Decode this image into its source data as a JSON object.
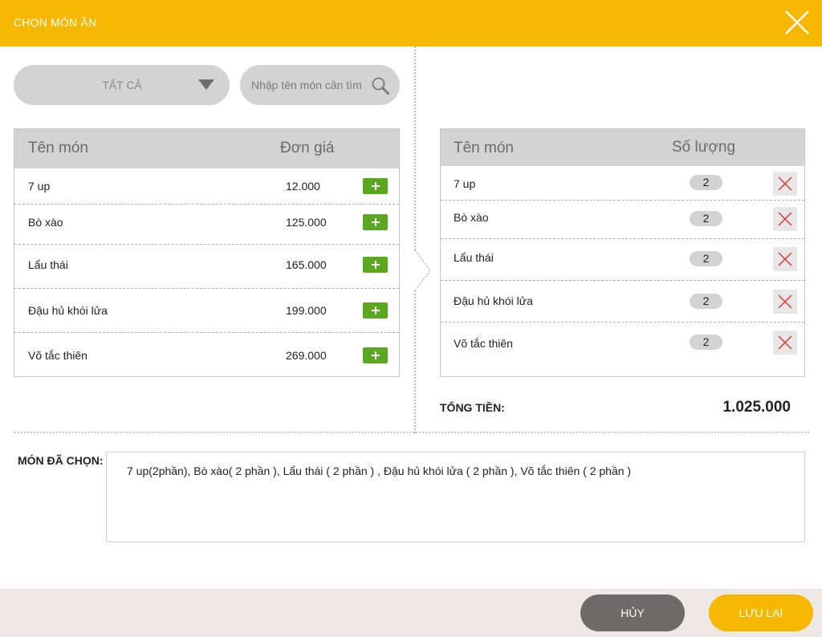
{
  "dialog": {
    "title": "CHỌN MÓN ĂN",
    "close_icon": "close-icon"
  },
  "filter": {
    "selected": "TẤT CẢ",
    "icon": "caret-down-icon"
  },
  "search": {
    "placeholder": "Nhập tên món cần tìm",
    "value": "",
    "icon": "search-icon"
  },
  "menu_table": {
    "headers": {
      "name": "Tên món",
      "price": "Đơn giá"
    },
    "rows": [
      {
        "name": "7 up",
        "price": "12.000"
      },
      {
        "name": "Bò xào",
        "price": "125.000"
      },
      {
        "name": "Lẩu thái",
        "price": "165.000"
      },
      {
        "name": "Đậu hủ khói lửa",
        "price": "199.000"
      },
      {
        "name": "Võ tắc thiên",
        "price": "269.000"
      }
    ]
  },
  "selected_table": {
    "headers": {
      "name": "Tên món",
      "qty": "Số lượng"
    },
    "rows": [
      {
        "name": "7 up",
        "qty": "2"
      },
      {
        "name": "Bò xào",
        "qty": "2"
      },
      {
        "name": "Lẩu thái",
        "qty": "2"
      },
      {
        "name": "Đậu hủ khói lửa",
        "qty": "2"
      },
      {
        "name": "Võ tắc thiên",
        "qty": "2"
      }
    ]
  },
  "total": {
    "label": "TỔNG TIỀN:",
    "value": "1.025.000"
  },
  "chosen": {
    "label": "MÓN ĐÃ CHỌN:",
    "text": "7 up(2phần), Bò xào( 2 phần ), Lẩu thái ( 2 phần ) , Đậu hủ khói lửa ( 2 phần ), Võ tắc thiên ( 2 phần )"
  },
  "footer": {
    "cancel_label": "HỦY",
    "save_label": "LƯU LẠI"
  },
  "colors": {
    "accent": "#f5b700",
    "add_green": "#5aa81f",
    "delete_red": "#e0332f",
    "cancel_gray": "#6e6a69",
    "panel_gray": "#d3d3d3"
  }
}
